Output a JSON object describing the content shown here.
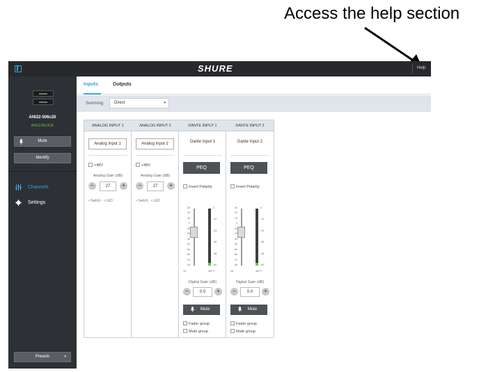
{
  "annotation": {
    "callout_text": "Access the help section"
  },
  "topbar": {
    "brand": "SHURE",
    "help_label": "Help"
  },
  "sidebar": {
    "device_name": "ANI22-506c20",
    "device_group": "ANI22-BLOCK",
    "mute_label": "Mute",
    "identify_label": "Identify",
    "nav": [
      {
        "label": "Channels",
        "icon": "channels-sliders-icon",
        "active": true
      },
      {
        "label": "Settings",
        "icon": "gear-icon",
        "active": false
      }
    ],
    "presets_label": "Presets"
  },
  "tabs": [
    {
      "label": "Inputs",
      "active": true
    },
    {
      "label": "Outputs",
      "active": false
    }
  ],
  "summing": {
    "label": "Summing",
    "value": "Direct"
  },
  "channels": {
    "analog": [
      {
        "header": "ANALOG INPUT 1",
        "name": "Analog Input 1",
        "phantom_label": "+48V",
        "gain_label": "Analog Gain (dB)",
        "gain_value": "27",
        "switch_label": "Switch",
        "led_label": "LED"
      },
      {
        "header": "ANALOG INPUT 2",
        "name": "Analog Input 2",
        "phantom_label": "+48V",
        "gain_label": "Analog Gain (dB)",
        "gain_value": "27",
        "switch_label": "Switch",
        "led_label": "LED"
      }
    ],
    "dante": [
      {
        "header": "DANTE INPUT 1",
        "name": "Dante Input 1",
        "peq_label": "PEQ",
        "invert_label": "Invert Polarity",
        "gain_label": "Digital Gain (dB)",
        "gain_value": "0.0",
        "mute_label": "Mute",
        "fader_group_label": "Fader group",
        "mute_group_label": "Mute group"
      },
      {
        "header": "DANTE INPUT 2",
        "name": "Dante Input 2",
        "peq_label": "PEQ",
        "invert_label": "Invert Polarity",
        "gain_label": "Digital Gain (dB)",
        "gain_value": "0.0",
        "mute_label": "Mute",
        "fader_group_label": "Fader group",
        "mute_group_label": "Mute group"
      }
    ],
    "fader_scale": [
      "30",
      "20",
      "10",
      "0",
      "-10",
      "-20",
      "-30",
      "-40",
      "-50",
      "-60",
      "-70",
      "-inf"
    ],
    "meter_scale": [
      "0",
      "-12",
      "-24",
      "-36",
      "-48",
      "-60"
    ],
    "fader_foot_left": "dB",
    "fader_foot_right": "dBFS"
  }
}
